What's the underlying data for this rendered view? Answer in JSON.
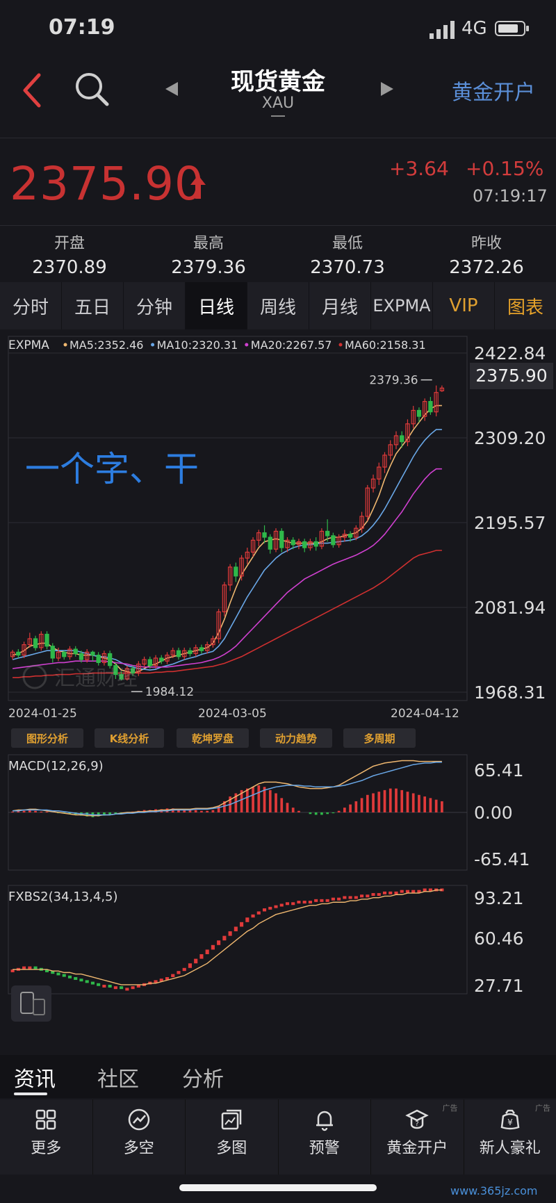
{
  "status": {
    "time": "07:19",
    "network": "4G"
  },
  "header": {
    "title": "现货黄金",
    "code": "XAU",
    "open_account": "黄金开户"
  },
  "quote": {
    "price": "2375.90",
    "change": "+3.64",
    "change_pct": "+0.15%",
    "time": "07:19:17",
    "up_color": "#d33c3c",
    "stats": [
      {
        "label": "开盘",
        "value": "2370.89"
      },
      {
        "label": "最高",
        "value": "2379.36"
      },
      {
        "label": "最低",
        "value": "2370.73"
      },
      {
        "label": "昨收",
        "value": "2372.26"
      }
    ]
  },
  "tabs": [
    "分时",
    "五日",
    "分钟",
    "日线",
    "周线",
    "月线",
    "EXPMA",
    "VIP",
    "图表"
  ],
  "active_tab": "日线",
  "chart_data": {
    "type": "candlestick",
    "indicator_name": "EXPMA",
    "legend": [
      {
        "label": "MA5:2352.46",
        "color": "#f0b870"
      },
      {
        "label": "MA10:2320.31",
        "color": "#6aa8e8"
      },
      {
        "label": "MA20:2267.57",
        "color": "#d040d0"
      },
      {
        "label": "MA60:2158.31",
        "color": "#d03030"
      }
    ],
    "y_ticks": [
      "2422.84",
      "2309.20",
      "2195.57",
      "2081.94",
      "1968.31"
    ],
    "ylim": [
      1968.31,
      2422.84
    ],
    "current_price_label": "2375.90",
    "high_label": "2379.36",
    "low_label": "1984.12",
    "dates": [
      "2024-01-25",
      "2024-03-05",
      "2024-04-12"
    ],
    "annotation": "一个字、干",
    "candles": [
      [
        2016,
        2022,
        2012,
        2025
      ],
      [
        2022,
        2018,
        2014,
        2026
      ],
      [
        2018,
        2032,
        2014,
        2036
      ],
      [
        2032,
        2040,
        2028,
        2048
      ],
      [
        2040,
        2028,
        2024,
        2044
      ],
      [
        2028,
        2046,
        2024,
        2050
      ],
      [
        2046,
        2030,
        2026,
        2050
      ],
      [
        2030,
        2014,
        2008,
        2034
      ],
      [
        2014,
        2022,
        2010,
        2028
      ],
      [
        2022,
        2016,
        2012,
        2024
      ],
      [
        2016,
        2026,
        2012,
        2030
      ],
      [
        2026,
        2020,
        2016,
        2030
      ],
      [
        2020,
        2012,
        2008,
        2024
      ],
      [
        2012,
        2022,
        2008,
        2026
      ],
      [
        2022,
        2018,
        2010,
        2024
      ],
      [
        2018,
        2008,
        2004,
        2022
      ],
      [
        2008,
        2020,
        2004,
        2024
      ],
      [
        2020,
        2004,
        2000,
        2024
      ],
      [
        2004,
        1992,
        1986,
        2008
      ],
      [
        1992,
        1986,
        1984.12,
        1996
      ],
      [
        1986,
        2000,
        1984,
        2004
      ],
      [
        2000,
        1994,
        1990,
        2004
      ],
      [
        1994,
        2006,
        1990,
        2010
      ],
      [
        2006,
        2012,
        2002,
        2016
      ],
      [
        2012,
        2004,
        2000,
        2016
      ],
      [
        2004,
        2014,
        2000,
        2018
      ],
      [
        2014,
        2010,
        2006,
        2018
      ],
      [
        2010,
        2018,
        2006,
        2022
      ],
      [
        2018,
        2024,
        2014,
        2028
      ],
      [
        2024,
        2016,
        2012,
        2028
      ],
      [
        2016,
        2024,
        2012,
        2028
      ],
      [
        2024,
        2020,
        2016,
        2028
      ],
      [
        2020,
        2028,
        2016,
        2032
      ],
      [
        2028,
        2024,
        2020,
        2032
      ],
      [
        2024,
        2032,
        2020,
        2036
      ],
      [
        2032,
        2040,
        2028,
        2044
      ],
      [
        2040,
        2076,
        2034,
        2080
      ],
      [
        2076,
        2112,
        2070,
        2116
      ],
      [
        2112,
        2136,
        2104,
        2140
      ],
      [
        2136,
        2124,
        2116,
        2142
      ],
      [
        2124,
        2148,
        2118,
        2152
      ],
      [
        2148,
        2156,
        2140,
        2162
      ],
      [
        2156,
        2172,
        2150,
        2176
      ],
      [
        2172,
        2182,
        2164,
        2186
      ],
      [
        2182,
        2176,
        2168,
        2192
      ],
      [
        2176,
        2160,
        2154,
        2180
      ],
      [
        2160,
        2184,
        2156,
        2188
      ],
      [
        2184,
        2162,
        2156,
        2188
      ],
      [
        2162,
        2172,
        2156,
        2176
      ],
      [
        2172,
        2166,
        2160,
        2176
      ],
      [
        2166,
        2170,
        2160,
        2174
      ],
      [
        2170,
        2162,
        2156,
        2174
      ],
      [
        2162,
        2170,
        2158,
        2174
      ],
      [
        2170,
        2164,
        2158,
        2176
      ],
      [
        2164,
        2184,
        2160,
        2188
      ],
      [
        2184,
        2178,
        2170,
        2200
      ],
      [
        2178,
        2166,
        2162,
        2182
      ],
      [
        2166,
        2176,
        2162,
        2180
      ],
      [
        2176,
        2180,
        2170,
        2186
      ],
      [
        2180,
        2176,
        2170,
        2184
      ],
      [
        2176,
        2188,
        2172,
        2192
      ],
      [
        2188,
        2204,
        2182,
        2210
      ],
      [
        2204,
        2242,
        2198,
        2246
      ],
      [
        2242,
        2254,
        2236,
        2260
      ],
      [
        2254,
        2270,
        2246,
        2276
      ],
      [
        2270,
        2286,
        2262,
        2290
      ],
      [
        2286,
        2300,
        2280,
        2306
      ],
      [
        2300,
        2312,
        2294,
        2318
      ],
      [
        2312,
        2304,
        2296,
        2318
      ],
      [
        2304,
        2328,
        2298,
        2334
      ],
      [
        2328,
        2346,
        2322,
        2352
      ],
      [
        2346,
        2338,
        2330,
        2350
      ],
      [
        2338,
        2358,
        2332,
        2362
      ],
      [
        2358,
        2344,
        2340,
        2364
      ],
      [
        2344,
        2370,
        2338,
        2379.36
      ],
      [
        2372.26,
        2375.9,
        2370.73,
        2379.36
      ]
    ],
    "ma": {
      "MA5": [
        2018,
        2020,
        2024,
        2030,
        2032,
        2034,
        2034,
        2028,
        2024,
        2022,
        2020,
        2020,
        2018,
        2018,
        2018,
        2016,
        2014,
        2012,
        2006,
        1998,
        1996,
        1994,
        1996,
        2000,
        2004,
        2006,
        2010,
        2014,
        2016,
        2018,
        2020,
        2022,
        2024,
        2026,
        2028,
        2034,
        2048,
        2066,
        2088,
        2108,
        2126,
        2138,
        2150,
        2162,
        2170,
        2172,
        2174,
        2172,
        2170,
        2168,
        2168,
        2168,
        2168,
        2168,
        2170,
        2174,
        2176,
        2176,
        2178,
        2180,
        2182,
        2188,
        2198,
        2214,
        2232,
        2254,
        2272,
        2288,
        2298,
        2308,
        2320,
        2330,
        2340,
        2348,
        2352.46,
        2352.46
      ],
      "MA10": [
        2012,
        2014,
        2016,
        2018,
        2020,
        2022,
        2024,
        2024,
        2024,
        2024,
        2024,
        2024,
        2022,
        2020,
        2018,
        2016,
        2016,
        2014,
        2012,
        2008,
        2004,
        2002,
        2000,
        1999,
        1998,
        1999,
        2002,
        2004,
        2006,
        2009,
        2012,
        2014,
        2016,
        2019,
        2021,
        2023,
        2030,
        2040,
        2054,
        2068,
        2082,
        2096,
        2108,
        2120,
        2132,
        2140,
        2148,
        2154,
        2158,
        2162,
        2164,
        2166,
        2166,
        2167,
        2168,
        2168,
        2169,
        2170,
        2171,
        2172,
        2174,
        2178,
        2184,
        2192,
        2202,
        2214,
        2228,
        2242,
        2256,
        2270,
        2284,
        2296,
        2306,
        2314,
        2320.31,
        2320.31
      ],
      "MA20": [
        2000,
        2001,
        2002,
        2003,
        2004,
        2005,
        2006,
        2007,
        2008,
        2008,
        2009,
        2010,
        2010,
        2010,
        2010,
        2010,
        2010,
        2009,
        2008,
        2007,
        2006,
        2004,
        2003,
        2002,
        2002,
        2002,
        2002,
        2002,
        2003,
        2004,
        2005,
        2006,
        2007,
        2008,
        2010,
        2012,
        2015,
        2019,
        2024,
        2030,
        2038,
        2046,
        2054,
        2062,
        2070,
        2078,
        2086,
        2094,
        2102,
        2108,
        2114,
        2120,
        2124,
        2128,
        2132,
        2136,
        2140,
        2143,
        2146,
        2149,
        2152,
        2156,
        2160,
        2165,
        2172,
        2180,
        2190,
        2200,
        2210,
        2222,
        2234,
        2244,
        2254,
        2262,
        2267.57,
        2267.57
      ],
      "MA60": [
        1988,
        1988,
        1989,
        1989,
        1990,
        1990,
        1991,
        1991,
        1992,
        1992,
        1992,
        1993,
        1993,
        1993,
        1994,
        1994,
        1994,
        1994,
        1994,
        1994,
        1994,
        1994,
        1994,
        1994,
        1994,
        1995,
        1995,
        1996,
        1996,
        1997,
        1998,
        1999,
        2000,
        2001,
        2002,
        2003,
        2005,
        2007,
        2010,
        2013,
        2016,
        2020,
        2024,
        2028,
        2032,
        2036,
        2040,
        2044,
        2048,
        2052,
        2056,
        2060,
        2064,
        2068,
        2072,
        2076,
        2080,
        2084,
        2088,
        2092,
        2096,
        2100,
        2104,
        2108,
        2113,
        2118,
        2124,
        2130,
        2136,
        2142,
        2148,
        2152,
        2154,
        2156,
        2158.31,
        2158.31
      ]
    },
    "buttons": [
      "图形分析",
      "K线分析",
      "乾坤罗盘",
      "动力趋势",
      "多周期"
    ],
    "macd": {
      "label": "MACD(12,26,9)",
      "y_ticks": [
        "65.41",
        "0.00",
        "-65.41"
      ],
      "ylim": [
        -65.41,
        65.41
      ],
      "hist": [
        1,
        2,
        2,
        3,
        2,
        1,
        1,
        0,
        -1,
        -1,
        -2,
        -3,
        -4,
        -5,
        -6,
        -5,
        -4,
        -3,
        -2,
        -1,
        0,
        1,
        2,
        3,
        3,
        4,
        4,
        5,
        5,
        4,
        4,
        3,
        3,
        2,
        2,
        3,
        8,
        14,
        20,
        24,
        28,
        30,
        32,
        34,
        32,
        28,
        24,
        18,
        12,
        6,
        2,
        0,
        -2,
        -3,
        -3,
        -2,
        -1,
        2,
        6,
        10,
        14,
        18,
        22,
        24,
        26,
        28,
        30,
        30,
        28,
        26,
        24,
        22,
        20,
        18,
        16,
        14
      ],
      "dif": [
        2,
        3,
        3,
        4,
        4,
        3,
        2,
        1,
        0,
        -1,
        -2,
        -3,
        -3,
        -4,
        -4,
        -4,
        -3,
        -3,
        -2,
        -1,
        0,
        0,
        1,
        1,
        2,
        2,
        3,
        3,
        4,
        4,
        4,
        4,
        5,
        5,
        5,
        6,
        8,
        12,
        16,
        20,
        24,
        28,
        32,
        36,
        38,
        38,
        38,
        37,
        36,
        34,
        32,
        31,
        30,
        30,
        30,
        31,
        32,
        34,
        38,
        42,
        46,
        50,
        54,
        58,
        60,
        62,
        63,
        64,
        65,
        65,
        65,
        64,
        64,
        64,
        64,
        64
      ],
      "dea": [
        2,
        2,
        3,
        3,
        3,
        3,
        3,
        2,
        2,
        1,
        0,
        -1,
        -2,
        -2,
        -3,
        -3,
        -3,
        -3,
        -2,
        -2,
        -1,
        -1,
        0,
        0,
        1,
        1,
        2,
        2,
        3,
        3,
        3,
        3,
        4,
        4,
        4,
        5,
        6,
        8,
        10,
        13,
        16,
        19,
        22,
        25,
        28,
        30,
        32,
        33,
        34,
        34,
        34,
        33,
        33,
        32,
        32,
        32,
        32,
        33,
        34,
        36,
        38,
        40,
        43,
        46,
        48,
        50,
        52,
        54,
        56,
        58,
        60,
        61,
        62,
        62,
        63,
        63
      ]
    },
    "fxbs": {
      "label": "FXBS2(34,13,4,5)",
      "y_ticks": [
        "93.21",
        "60.46",
        "27.71"
      ],
      "ylim": [
        27.71,
        93.21
      ],
      "values": [
        40,
        41,
        42,
        42,
        41,
        40,
        39,
        38,
        37,
        36,
        35,
        34,
        33,
        32,
        31,
        30,
        30,
        29,
        29,
        28,
        28,
        29,
        30,
        31,
        32,
        33,
        34,
        35,
        37,
        39,
        41,
        44,
        47,
        50,
        53,
        56,
        59,
        62,
        65,
        68,
        71,
        74,
        76,
        78,
        80,
        81,
        82,
        83,
        84,
        84,
        85,
        85,
        85,
        86,
        86,
        86,
        87,
        87,
        88,
        88,
        88,
        89,
        89,
        90,
        90,
        91,
        91,
        91,
        92,
        92,
        92,
        92,
        93,
        93,
        93,
        93
      ],
      "signal": [
        40,
        40,
        40,
        40,
        40,
        40,
        40,
        39,
        39,
        38,
        38,
        37,
        37,
        36,
        35,
        34,
        33,
        32,
        31,
        30,
        30,
        30,
        30,
        30,
        31,
        31,
        32,
        33,
        34,
        35,
        36,
        38,
        40,
        42,
        44,
        47,
        50,
        53,
        56,
        59,
        62,
        65,
        67,
        70,
        72,
        74,
        76,
        77,
        78,
        79,
        80,
        81,
        82,
        82,
        83,
        83,
        84,
        84,
        84,
        85,
        85,
        86,
        86,
        87,
        87,
        88,
        88,
        89,
        89,
        90,
        90,
        90,
        91,
        91,
        92,
        92
      ]
    }
  },
  "news_tabs": [
    "资讯",
    "社区",
    "分析"
  ],
  "bottom_nav": [
    {
      "label": "更多",
      "icon": "grid-icon",
      "ad": ""
    },
    {
      "label": "多空",
      "icon": "trend-circle-icon",
      "ad": ""
    },
    {
      "label": "多图",
      "icon": "multi-chart-icon",
      "ad": ""
    },
    {
      "label": "预警",
      "icon": "bell-icon",
      "ad": ""
    },
    {
      "label": "黄金开户",
      "icon": "hat-icon",
      "ad": "广告"
    },
    {
      "label": "新人豪礼",
      "icon": "gift-bag-icon",
      "ad": "广告"
    }
  ],
  "watermark": "www.365jz.com"
}
